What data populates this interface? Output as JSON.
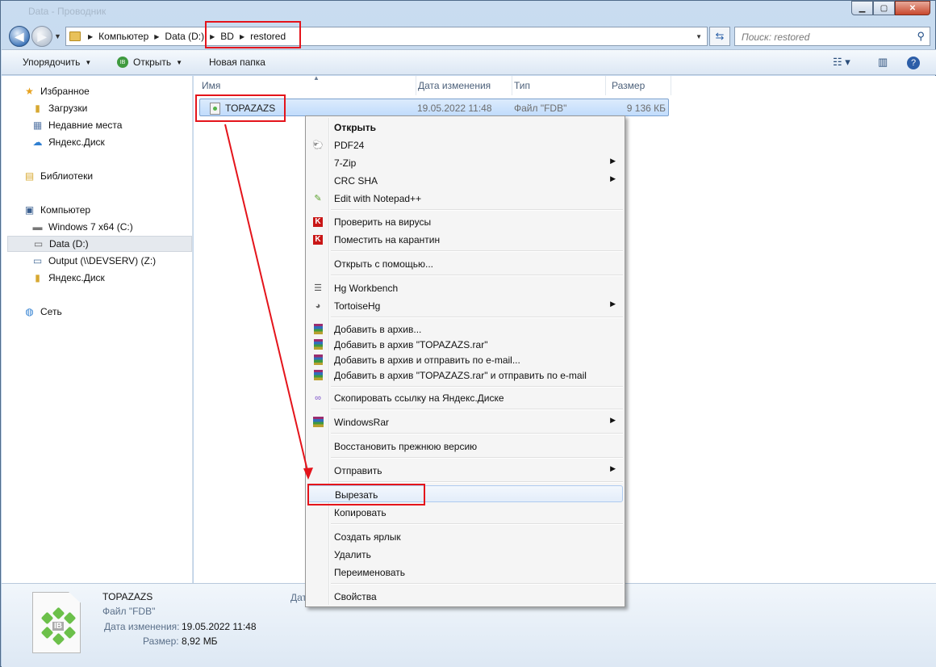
{
  "window": {
    "title": "Data - Проводник",
    "buttons": {
      "minimize": "▁",
      "maximize": "▢",
      "close": "✕"
    }
  },
  "address": {
    "crumbs": [
      "Компьютер",
      "Data (D:)",
      "BD",
      "restored"
    ],
    "search_placeholder": "Поиск: restored"
  },
  "toolbar": {
    "organize": "Упорядочить",
    "open": "Открыть",
    "new_folder": "Новая папка"
  },
  "nav": {
    "favorites": "Избранное",
    "downloads": "Загрузки",
    "recent": "Недавние места",
    "yadisk_fav": "Яндекс.Диск",
    "libraries": "Библиотеки",
    "computer": "Компьютер",
    "drive_c": "Windows 7 x64 (C:)",
    "drive_d": "Data (D:)",
    "drive_z": "Output (\\\\DEVSERV) (Z:)",
    "yadisk": "Яндекс.Диск",
    "network": "Сеть"
  },
  "columns": {
    "name": "Имя",
    "date": "Дата изменения",
    "type": "Тип",
    "size": "Размер"
  },
  "file": {
    "name": "TOPAZAZS",
    "date": "19.05.2022 11:48",
    "type": "Файл \"FDB\"",
    "size": "9 136 КБ"
  },
  "context_menu": {
    "open": "Открыть",
    "pdf24": "PDF24",
    "zip7": "7-Zip",
    "crc": "CRC SHA",
    "notepad": "Edit with Notepad++",
    "scan": "Проверить на вирусы",
    "quarantine": "Поместить на карантин",
    "open_with": "Открыть с помощью...",
    "hg_workbench": "Hg Workbench",
    "tortoisehg": "TortoiseHg",
    "add_archive": "Добавить в архив...",
    "add_rar": "Добавить в архив \"TOPAZAZS.rar\"",
    "add_email": "Добавить в архив и отправить по e-mail...",
    "add_rar_email": "Добавить в архив \"TOPAZAZS.rar\" и отправить по e-mail",
    "copy_link_yadisk": "Скопировать ссылку на Яндекс.Диске",
    "windowsrar": "WindowsRar",
    "restore_prev": "Восстановить прежнюю версию",
    "send_to": "Отправить",
    "cut": "Вырезать",
    "copy": "Копировать",
    "create_shortcut": "Создать ярлык",
    "delete": "Удалить",
    "rename": "Переименовать",
    "properties": "Свойства"
  },
  "details": {
    "name": "TOPAZAZS",
    "type": "Файл \"FDB\"",
    "date_label": "Дата изменения:",
    "date_value": "19.05.2022 11:48",
    "size_label": "Размер:",
    "size_value": "8,92 МБ",
    "hidden_label": "Дат"
  },
  "colors": {
    "annotation": "#e4141b",
    "selection": "#c1dcfc",
    "menu_bg": "#f5f5f5"
  }
}
